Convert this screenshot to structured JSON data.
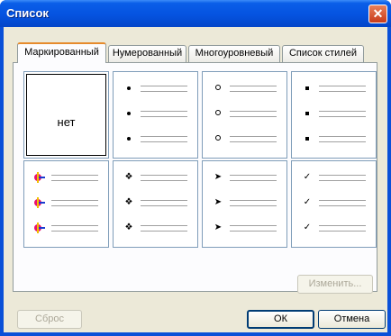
{
  "window": {
    "title": "Список",
    "close_label": "✕"
  },
  "tabs": [
    {
      "label": "Маркированный",
      "active": true
    },
    {
      "label": "Нумерованный",
      "active": false
    },
    {
      "label": "Многоуровневый",
      "active": false
    },
    {
      "label": "Список стилей",
      "active": false
    }
  ],
  "gallery": {
    "none_label": "нет",
    "cells": [
      {
        "name": "none"
      },
      {
        "name": "filled-circle",
        "bullet": "dot"
      },
      {
        "name": "hollow-circle",
        "bullet": "circ"
      },
      {
        "name": "filled-square",
        "bullet": "sq"
      },
      {
        "name": "color-pin",
        "bullet": "pin"
      },
      {
        "name": "four-diamond",
        "bullet": "❖"
      },
      {
        "name": "arrowhead",
        "bullet": "➤"
      },
      {
        "name": "checkmark",
        "bullet": "✓"
      }
    ]
  },
  "buttons": {
    "change": "Изменить...",
    "reset": "Сброс",
    "ok": "ОК",
    "cancel": "Отмена"
  }
}
